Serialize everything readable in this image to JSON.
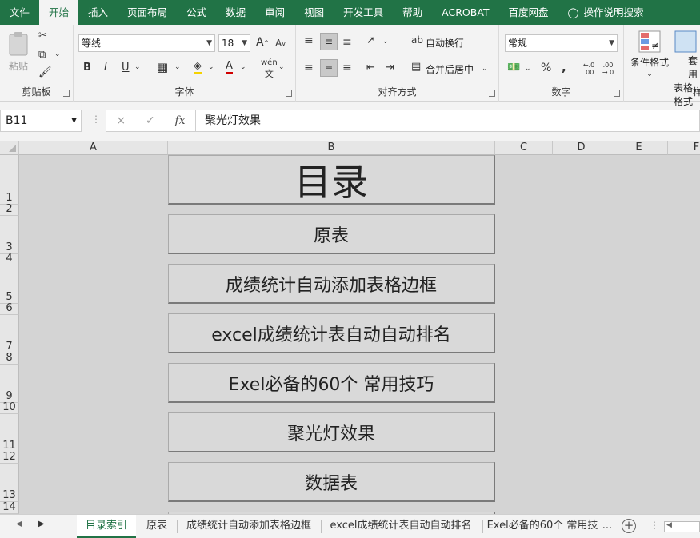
{
  "ribbon_tabs": [
    "文件",
    "开始",
    "插入",
    "页面布局",
    "公式",
    "数据",
    "审阅",
    "视图",
    "开发工具",
    "帮助",
    "ACROBAT",
    "百度网盘",
    "操作说明搜索"
  ],
  "clipboard": {
    "paste_label": "粘贴",
    "group_label": "剪贴板"
  },
  "font": {
    "name": "等线",
    "size": "18",
    "group_label": "字体",
    "phonetic": "wén"
  },
  "alignment": {
    "wrap_label": "自动换行",
    "merge_label": "合并后居中",
    "group_label": "对齐方式"
  },
  "number": {
    "format": "常规",
    "percent": "%",
    "comma": ",",
    "group_label": "数字",
    "inc_decimal": "←.0 .00",
    "dec_decimal": ".00 →.0"
  },
  "styles": {
    "cond_label": "条件格式",
    "table_label1": "套用",
    "table_label2": "表格格式",
    "group_label_partial": "样"
  },
  "formula_bar": {
    "name_box": "B11",
    "cancel": "×",
    "enter": "✓",
    "fx": "fx",
    "content": "聚光灯效果"
  },
  "columns": [
    "A",
    "B",
    "C",
    "D",
    "E",
    "F"
  ],
  "rows": [
    "1",
    "2",
    "3",
    "4",
    "5",
    "6",
    "7",
    "8",
    "9",
    "10",
    "11",
    "12",
    "13",
    "14"
  ],
  "shapes": [
    "目录",
    "原表",
    "成绩统计自动添加表格边框",
    "excel成绩统计表自动自动排名",
    "Exel必备的60个 常用技巧",
    "聚光灯效果",
    "数据表"
  ],
  "sheet_tabs": [
    "目录索引",
    "原表",
    "成绩统计自动添加表格边框",
    "excel成绩统计表自动自动排名",
    "Exel必备的60个 常用技"
  ],
  "sheet_more": "...",
  "colors": {
    "excel_green": "#217346",
    "grid_bg": "#d4d4d4",
    "shape_fill": "#d9d9d9"
  }
}
